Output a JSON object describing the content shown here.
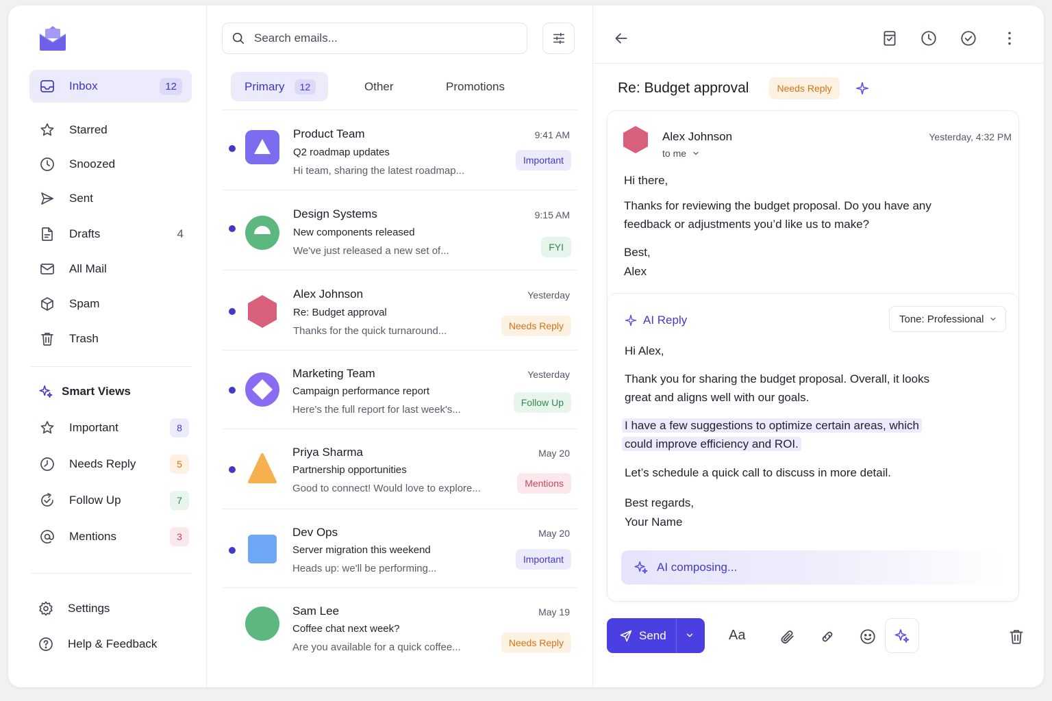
{
  "sidebar": {
    "nav": [
      {
        "label": "Inbox",
        "count": "12",
        "icon": "inbox-icon"
      },
      {
        "label": "Starred",
        "count": "",
        "icon": "star-icon"
      },
      {
        "label": "Snoozed",
        "count": "",
        "icon": "clock-icon"
      },
      {
        "label": "Sent",
        "count": "",
        "icon": "send-icon"
      },
      {
        "label": "Drafts",
        "count": "4",
        "icon": "draft-icon"
      },
      {
        "label": "All Mail",
        "count": "",
        "icon": "mail-icon"
      },
      {
        "label": "Spam",
        "count": "",
        "icon": "spam-icon"
      },
      {
        "label": "Trash",
        "count": "",
        "icon": "trash-icon"
      }
    ],
    "smart_views_title": "Smart Views",
    "smart_views": [
      {
        "label": "Important",
        "count": "8",
        "color": "#4338ca",
        "bg": "#ecebfb"
      },
      {
        "label": "Needs Reply",
        "count": "5",
        "color": "#d57214",
        "bg": "#fdf1e2"
      },
      {
        "label": "Follow Up",
        "count": "7",
        "color": "#2f8a4e",
        "bg": "#e8f5ec"
      },
      {
        "label": "Mentions",
        "count": "3",
        "color": "#c8465e",
        "bg": "#fbe8ec"
      }
    ],
    "bottom": [
      {
        "label": "Settings"
      },
      {
        "label": "Help & Feedback"
      }
    ]
  },
  "list": {
    "search_placeholder": "Search emails...",
    "tabs": [
      {
        "label": "Primary",
        "count": "12"
      },
      {
        "label": "Other"
      },
      {
        "label": "Promotions"
      }
    ],
    "emails": [
      {
        "sender": "Product Team",
        "subject": "Q2 roadmap updates",
        "preview": "Hi team, sharing the latest roadmap...",
        "time": "9:41 AM",
        "label": "Important",
        "label_kind": "important",
        "avatar_color": "#7c6cf0",
        "avatar_shape": "triangle-in-square"
      },
      {
        "sender": "Design Systems",
        "subject": "New components released",
        "preview": "We've just released a new set of...",
        "time": "9:15 AM",
        "label": "FYI",
        "label_kind": "fyi",
        "avatar_color": "#5cb87f",
        "avatar_shape": "half-circle"
      },
      {
        "sender": "Alex Johnson",
        "subject": "Re: Budget approval",
        "preview": "Thanks for the quick turnaround...",
        "time": "Yesterday",
        "label": "Needs Reply",
        "label_kind": "needs",
        "avatar_color": "#d9607a",
        "avatar_shape": "hexagon"
      },
      {
        "sender": "Marketing Team",
        "subject": "Campaign performance report",
        "preview": "Here's the full report for last week's...",
        "time": "Yesterday",
        "label": "Follow Up",
        "label_kind": "follow",
        "avatar_color": "#8a6cf0",
        "avatar_shape": "diamond-in-circle"
      },
      {
        "sender": "Priya Sharma",
        "subject": "Partnership opportunities",
        "preview": "Good to connect! Would love to explore...",
        "time": "May 20",
        "label": "Mentions",
        "label_kind": "mentions",
        "avatar_color": "#f7b04e",
        "avatar_shape": "triangle"
      },
      {
        "sender": "Dev Ops",
        "subject": "Server migration this weekend",
        "preview": "Heads up: we'll be performing...",
        "time": "May 20",
        "label": "Important",
        "label_kind": "important",
        "avatar_color": "#6ea8f5",
        "avatar_shape": "square"
      },
      {
        "sender": "Sam Lee",
        "subject": "Coffee chat next week?",
        "preview": "Are you available for a quick coffee...",
        "time": "May 19",
        "label": "Needs Reply",
        "label_kind": "needs",
        "avatar_color": "#5cb87f",
        "avatar_shape": "circle"
      }
    ]
  },
  "reader": {
    "subject": "Re: Budget approval",
    "subject_label": "Needs Reply",
    "message": {
      "sender": "Alex Johnson",
      "to": "to me",
      "time": "Yesterday, 4:32 PM",
      "greeting": "Hi there,",
      "body_1": "Thanks for reviewing the budget proposal. Do you have any",
      "body_2": "feedback or adjustments you’d like us to make?",
      "signoff": "Best,",
      "name": "Alex"
    },
    "ai_reply": {
      "title": "AI Reply",
      "tone": "Tone: Professional",
      "greeting": "Hi Alex,",
      "p1_1": "Thank you for sharing the budget proposal. Overall, it looks",
      "p1_2": "great and aligns well with our goals.",
      "p2_1": "I have a few suggestions to optimize certain areas, which",
      "p2_2": "could improve efficiency and ROI.",
      "p3": "Let’s schedule a quick call to discuss in more detail.",
      "signoff": "Best regards,",
      "name": "Your Name",
      "composing": "AI composing..."
    },
    "send_label": "Send",
    "format_label": "Aa"
  },
  "colors": {
    "accent": "#4a3fe0",
    "accent_soft": "#ecebfb"
  }
}
